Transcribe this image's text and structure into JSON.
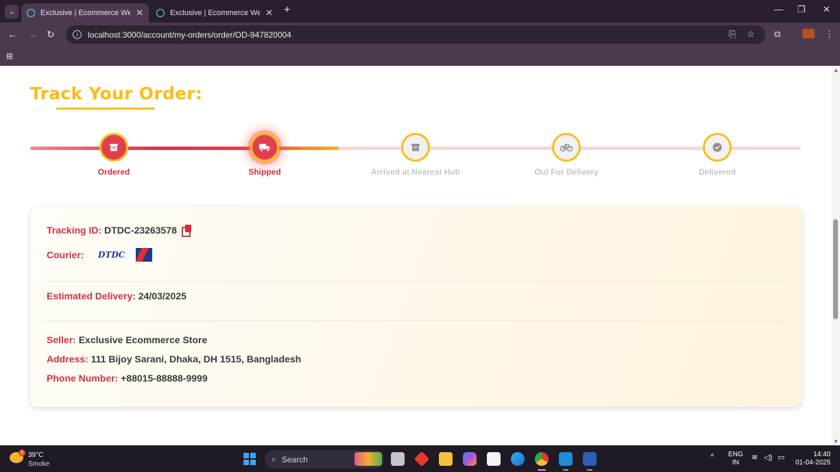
{
  "browser": {
    "tabs": [
      {
        "title": "Exclusive | Ecommerce Website",
        "active": true
      },
      {
        "title": "Exclusive | Ecommerce Website",
        "active": false
      }
    ],
    "url": "localhost:3000/account/my-orders/order/OD-947820004"
  },
  "page": {
    "title": "Track Your Order:",
    "progress": {
      "completed_steps": 2,
      "total_steps": 5
    },
    "steps": [
      {
        "label": "Ordered",
        "state": "done",
        "icon": "box-icon"
      },
      {
        "label": "Shipped",
        "state": "current",
        "icon": "truck-icon"
      },
      {
        "label": "Arrived at Nearest Hub",
        "state": "pending",
        "icon": "warehouse-icon"
      },
      {
        "label": "Out For Delivery",
        "state": "pending",
        "icon": "bicycle-icon"
      },
      {
        "label": "Delivered",
        "state": "pending",
        "icon": "check-circle-icon"
      }
    ],
    "details": {
      "tracking_label": "Tracking ID:",
      "tracking_id": "DTDC-23263578",
      "courier_label": "Courier:",
      "courier_logo_text": "DTDC",
      "estimated_label": "Estimated Delivery:",
      "estimated_date": "24/03/2025",
      "seller_label": "Seller:",
      "seller": "Exclusive Ecommerce Store",
      "address_label": "Address:",
      "address": "111 Bijoy Sarani, Dhaka, DH 1515, Bangladesh",
      "phone_label": "Phone Number:",
      "phone": "+88015-88888-9999"
    }
  },
  "taskbar": {
    "weather_temp": "39°C",
    "weather_condition": "Smoke",
    "weather_badge": "3",
    "search_placeholder": "Search",
    "lang_top": "ENG",
    "lang_bottom": "IN",
    "time": "14:40",
    "date": "01-04-2025"
  },
  "colors": {
    "accent_yellow": "#fbbd16",
    "accent_red": "#d4303f",
    "browser_frame": "#4b3a4f"
  }
}
